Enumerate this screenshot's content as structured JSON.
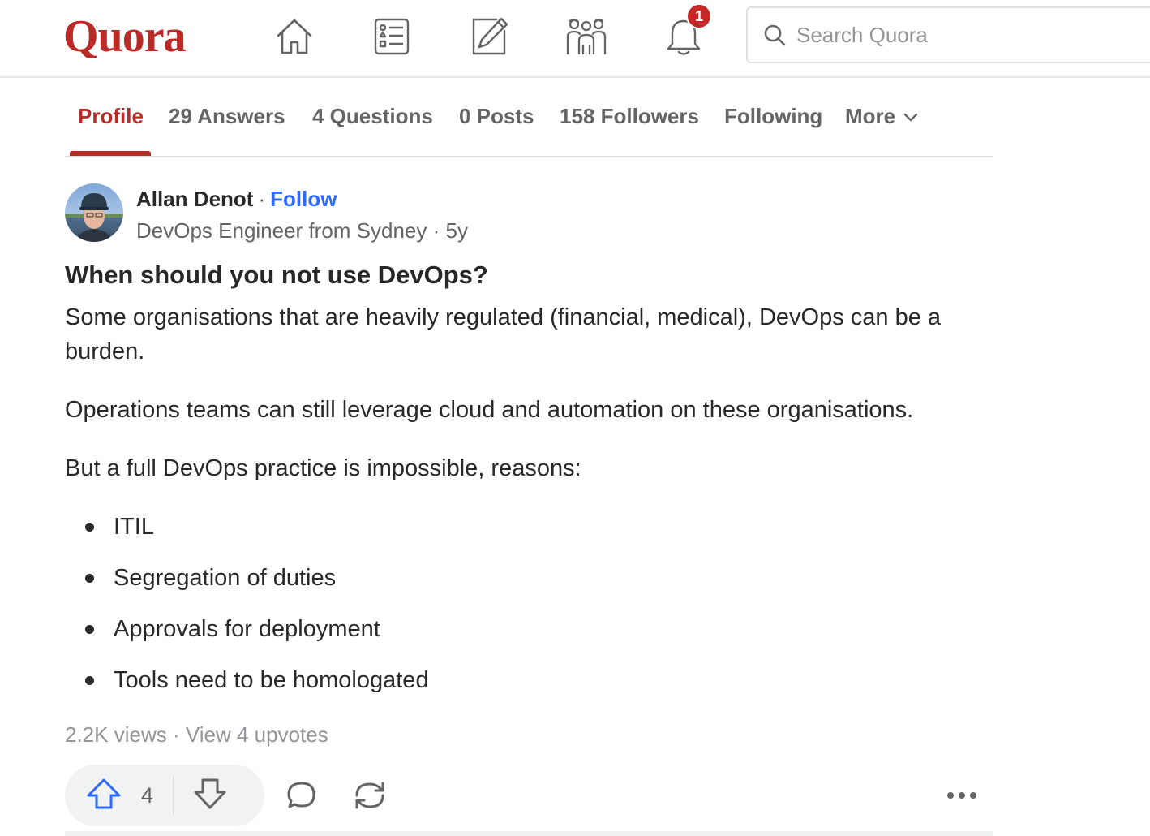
{
  "header": {
    "logo": "Quora",
    "nav_icons": [
      "home-icon",
      "following-feed-icon",
      "answer-icon",
      "spaces-icon",
      "notifications-icon"
    ],
    "notification_count": "1",
    "search": {
      "placeholder": "Search Quora",
      "value": ""
    }
  },
  "profile_tabs": {
    "items": [
      {
        "label": "Profile",
        "active": true
      },
      {
        "label": "29 Answers"
      },
      {
        "label": "4 Questions"
      },
      {
        "label": "0 Posts"
      },
      {
        "label": "158 Followers"
      },
      {
        "label": "Following"
      },
      {
        "label": "More"
      }
    ]
  },
  "answer": {
    "author": {
      "name": "Allan Denot",
      "separator": "·",
      "follow_label": "Follow",
      "credential": "DevOps Engineer from Sydney · 5y"
    },
    "question": "When should you not use DevOps?",
    "paragraphs": [
      "Some organisations that are heavily regulated (financial, medical), DevOps can be a burden.",
      "Operations teams can still leverage cloud and automation on these organisations.",
      "But a full DevOps practice is impossible, reasons:"
    ],
    "bullets": [
      "ITIL",
      "Segregation of duties",
      "Approvals for deployment",
      "Tools need to be homologated"
    ],
    "stats": {
      "views": "2.2K views",
      "separator": "·",
      "upvotes_link": "View 4 upvotes"
    },
    "actions": {
      "upvote_count": "4"
    }
  },
  "colors": {
    "brand": "#b92b27",
    "link": "#2e69ff",
    "text": "#282829",
    "muted": "#636466",
    "badge": "#c62828"
  }
}
